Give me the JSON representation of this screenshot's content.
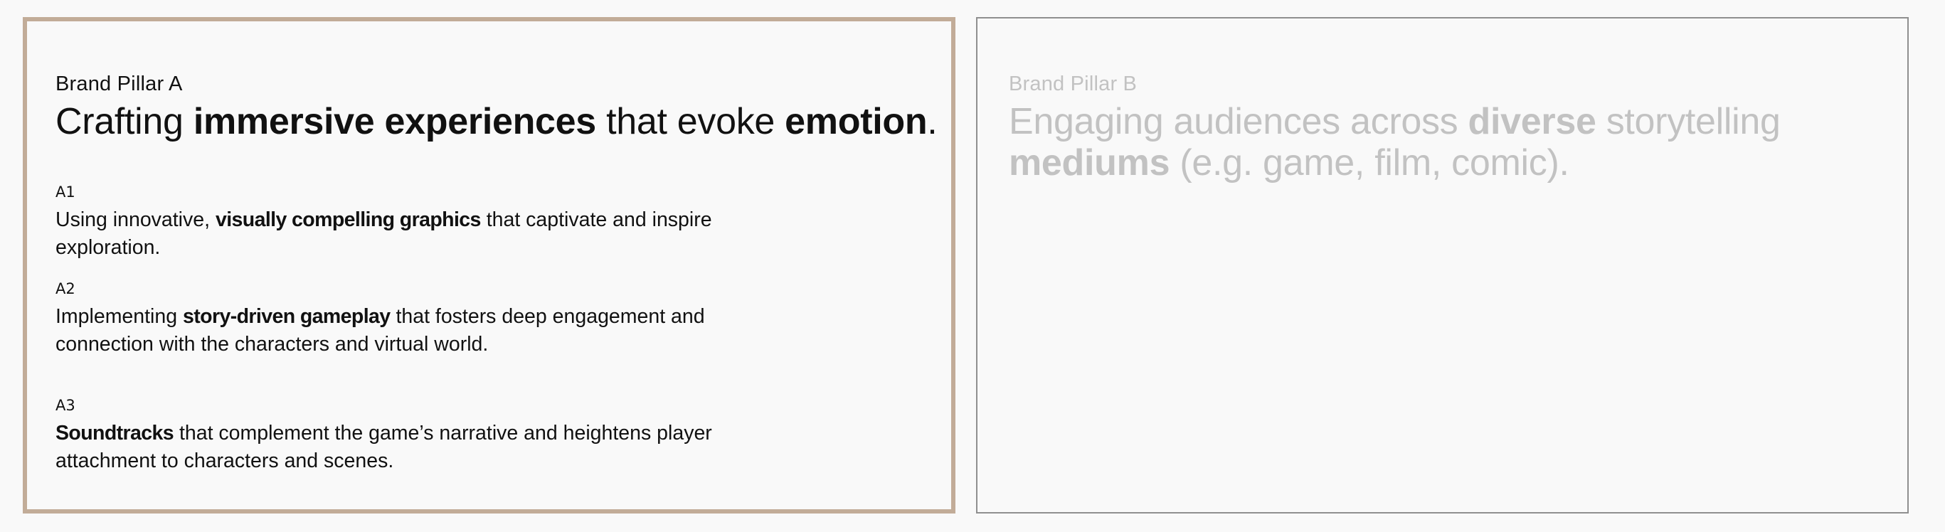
{
  "pillar_a": {
    "label": "Brand Pillar A",
    "headline": {
      "t1": "Crafting ",
      "b1": "immersive experiences",
      "t2": " that evoke ",
      "b2": "emotion",
      "t3": "."
    },
    "items": [
      {
        "code": "A1",
        "t1": "Using innovative, ",
        "b1": "visually compelling graphics",
        "t2": " that captivate and inspire exploration."
      },
      {
        "code": "A2",
        "t1": "Implementing ",
        "b1": "story-driven gameplay",
        "t2": " that fosters deep engagement and connection with the characters and virtual world."
      },
      {
        "code": "A3",
        "b1": "Soundtracks",
        "t2": " that complement the game’s narrative and heightens player attachment to characters and scenes."
      }
    ]
  },
  "pillar_b": {
    "label": "Brand Pillar B",
    "headline": {
      "t1": "Engaging audiences across ",
      "b1": "diverse",
      "t2": " storytelling ",
      "b2": "mediums",
      "t3": " (e.g. game, film, comic)."
    }
  },
  "colors": {
    "active_border": "#c2ac98",
    "inactive_border": "#8f8f8f",
    "inactive_text": "#c2c2c2",
    "background": "#f9f9f9"
  }
}
